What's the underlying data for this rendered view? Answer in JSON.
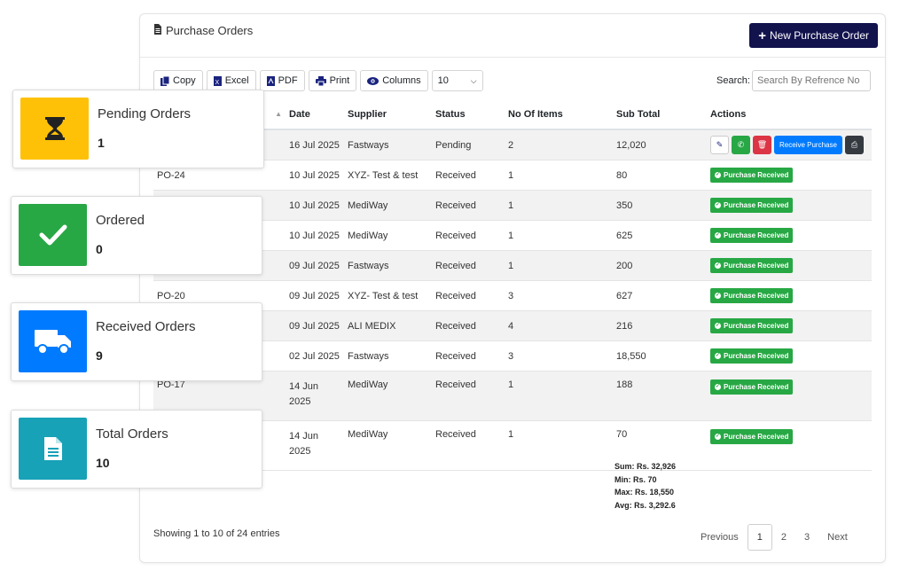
{
  "panel": {
    "title": "Purchase Orders",
    "new_button": "New Purchase Order"
  },
  "toolbar": {
    "copy": "Copy",
    "excel": "Excel",
    "pdf": "PDF",
    "print": "Print",
    "columns": "Columns",
    "page_length": "10",
    "search_label": "Search:",
    "search_placeholder": "Search By Refrence No"
  },
  "table": {
    "headers": [
      "",
      "Date",
      "Supplier",
      "Status",
      "No Of Items",
      "Sub Total",
      "Actions"
    ],
    "rows": [
      {
        "ref": "",
        "date": "16 Jul 2025",
        "supplier": "Fastways",
        "status": "Pending",
        "items": "2",
        "subtotal": "12,020"
      },
      {
        "ref": "PO-24",
        "date": "10 Jul 2025",
        "supplier": "XYZ- Test & test",
        "status": "Received",
        "items": "1",
        "subtotal": "80"
      },
      {
        "ref": "",
        "date": "10 Jul 2025",
        "supplier": "MediWay",
        "status": "Received",
        "items": "1",
        "subtotal": "350"
      },
      {
        "ref": "",
        "date": "10 Jul 2025",
        "supplier": "MediWay",
        "status": "Received",
        "items": "1",
        "subtotal": "625"
      },
      {
        "ref": "",
        "date": "09 Jul 2025",
        "supplier": "Fastways",
        "status": "Received",
        "items": "1",
        "subtotal": "200"
      },
      {
        "ref": "PO-20",
        "date": "09 Jul 2025",
        "supplier": "XYZ- Test & test",
        "status": "Received",
        "items": "3",
        "subtotal": "627"
      },
      {
        "ref": "",
        "date": "09 Jul 2025",
        "supplier": "ALI MEDIX",
        "status": "Received",
        "items": "4",
        "subtotal": "216"
      },
      {
        "ref": "",
        "date": "02 Jul 2025",
        "supplier": "Fastways",
        "status": "Received",
        "items": "3",
        "subtotal": "18,550"
      },
      {
        "ref": "PO-17",
        "date": "14 Jun 2025",
        "supplier": "MediWay",
        "status": "Received",
        "items": "1",
        "subtotal": "188"
      },
      {
        "ref": "",
        "date": "14 Jun 2025",
        "supplier": "MediWay",
        "status": "Received",
        "items": "1",
        "subtotal": "70"
      }
    ],
    "received_badge": "Purchase Received",
    "receive_button": "Receive Purchase"
  },
  "summary": {
    "sum": "Sum: Rs. 32,926",
    "min": "Min: Rs. 70",
    "max": "Max: Rs. 18,550",
    "avg": "Avg: Rs. 3,292.6"
  },
  "footer": {
    "showing": "Showing 1 to 10 of 24 entries",
    "previous": "Previous",
    "pages": [
      "1",
      "2",
      "3"
    ],
    "next": "Next"
  },
  "cards": [
    {
      "label": "Pending Orders",
      "value": "1",
      "color": "#ffc107",
      "icon": "hourglass-icon"
    },
    {
      "label": "Ordered",
      "value": "0",
      "color": "#28a745",
      "icon": "check-icon"
    },
    {
      "label": "Received Orders",
      "value": "9",
      "color": "#007bff",
      "icon": "truck-icon"
    },
    {
      "label": "Total Orders",
      "value": "10",
      "color": "#17a2b8",
      "icon": "document-icon"
    }
  ],
  "colors": {
    "primary_dark": "#12124d",
    "success": "#27a844",
    "danger": "#dc3545",
    "info": "#007bff",
    "dark": "#343a40"
  }
}
